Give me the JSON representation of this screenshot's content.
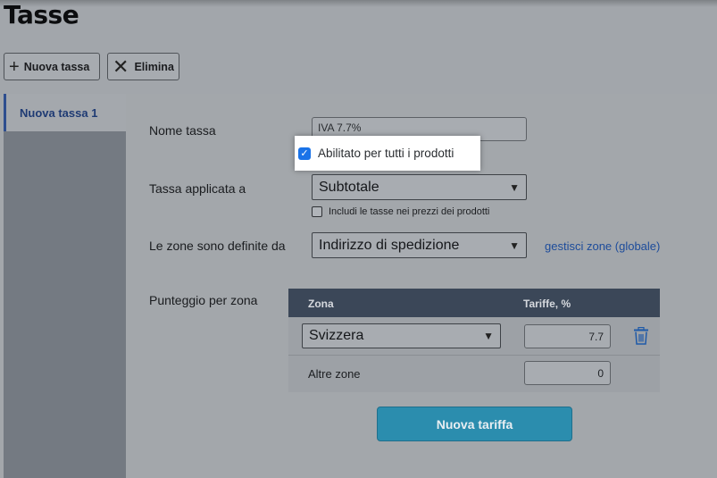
{
  "page": {
    "title": "Tasse"
  },
  "toolbar": {
    "new_tax_label": "Nuova tassa",
    "delete_label": "Elimina"
  },
  "sidebar": {
    "items": [
      {
        "label": "Nuova tassa 1",
        "selected": true
      }
    ]
  },
  "form": {
    "tax_name": {
      "label": "Nome tassa",
      "value": "IVA 7.7%"
    },
    "enabled_all_products": {
      "label": "Abilitato per tutti i prodotti",
      "checked": true
    },
    "applied_to": {
      "label": "Tassa applicata a",
      "selected": "Subtotale"
    },
    "include_in_prices": {
      "label": "Includi le tasse nei prezzi dei prodotti",
      "checked": false
    },
    "zones_defined_by": {
      "label": "Le zone sono definite da",
      "selected": "Indirizzo di spedizione"
    },
    "manage_zones_link": "gestisci zone (globale)",
    "rate_per_zone": {
      "label": "Punteggio per zona"
    }
  },
  "rates_table": {
    "headers": {
      "zone": "Zona",
      "rate": "Tariffe, %"
    },
    "rows": [
      {
        "zone": "Svizzera",
        "rate": "7.7"
      }
    ],
    "other_zones": {
      "label": "Altre zone",
      "rate": "0"
    }
  },
  "new_rate_button": "Nuova tariffa",
  "colors": {
    "accent": "#2b8dae",
    "header_bg": "#3b4758",
    "link": "#1d4c9b",
    "checkbox": "#1a73e8"
  }
}
